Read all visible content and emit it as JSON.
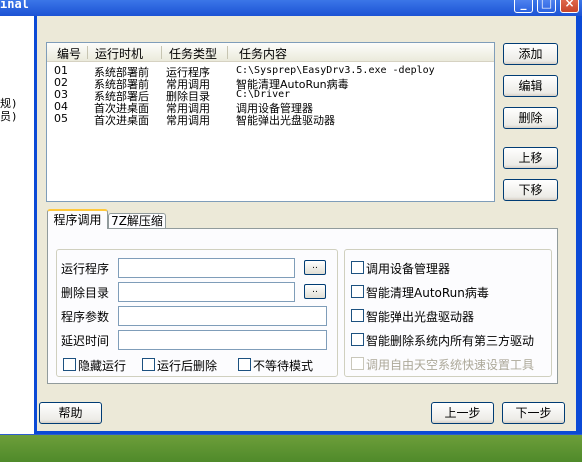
{
  "window": {
    "title_fragment": "inal",
    "controls": {
      "minimize": "_",
      "maximize": "□",
      "close": "×"
    }
  },
  "background_window": {
    "lines": [
      "规)",
      "员)"
    ]
  },
  "task_list": {
    "columns": [
      "编号",
      "运行时机",
      "任务类型",
      "任务内容"
    ],
    "rows": [
      {
        "id": "01",
        "timing": "系统部署前",
        "type": "运行程序",
        "content": "C:\\Sysprep\\EasyDrv3.5.exe -deploy"
      },
      {
        "id": "02",
        "timing": "系统部署前",
        "type": "常用调用",
        "content": "智能清理AutoRun病毒"
      },
      {
        "id": "03",
        "timing": "系统部署后",
        "type": "删除目录",
        "content": "C:\\Driver"
      },
      {
        "id": "04",
        "timing": "首次进桌面",
        "type": "常用调用",
        "content": "调用设备管理器"
      },
      {
        "id": "05",
        "timing": "首次进桌面",
        "type": "常用调用",
        "content": "智能弹出光盘驱动器"
      }
    ]
  },
  "side_buttons": {
    "add": "添加",
    "edit": "编辑",
    "delete": "删除",
    "up": "上移",
    "down": "下移"
  },
  "tabs": [
    {
      "label": "程序调用",
      "active": true
    },
    {
      "label": "7Z解压缩",
      "active": false
    }
  ],
  "form": {
    "run_program": {
      "label": "运行程序",
      "value": "",
      "browse": ".."
    },
    "delete_dir": {
      "label": "删除目录",
      "value": "",
      "browse": ".."
    },
    "params": {
      "label": "程序参数",
      "value": ""
    },
    "delay": {
      "label": "延迟时间",
      "value": ""
    },
    "checkboxes": [
      {
        "label": "隐藏运行",
        "checked": false
      },
      {
        "label": "运行后删除",
        "checked": false
      },
      {
        "label": "不等待模式",
        "checked": false
      }
    ]
  },
  "common_calls": [
    {
      "label": "调用设备管理器",
      "checked": false,
      "enabled": true
    },
    {
      "label": "智能清理AutoRun病毒",
      "checked": false,
      "enabled": true
    },
    {
      "label": "智能弹出光盘驱动器",
      "checked": false,
      "enabled": true
    },
    {
      "label": "智能删除系统内所有第三方驱动",
      "checked": false,
      "enabled": true
    },
    {
      "label": "调用自由天空系统快速设置工具",
      "checked": false,
      "enabled": false
    }
  ],
  "footer": {
    "help": "帮助",
    "prev": "上一步",
    "next": "下一步"
  },
  "colors": {
    "titlebar": "#1c52d4",
    "frame": "#0b4ad6",
    "dialog_bg": "#ece9d8",
    "tab_highlight": "#ffc83c"
  }
}
